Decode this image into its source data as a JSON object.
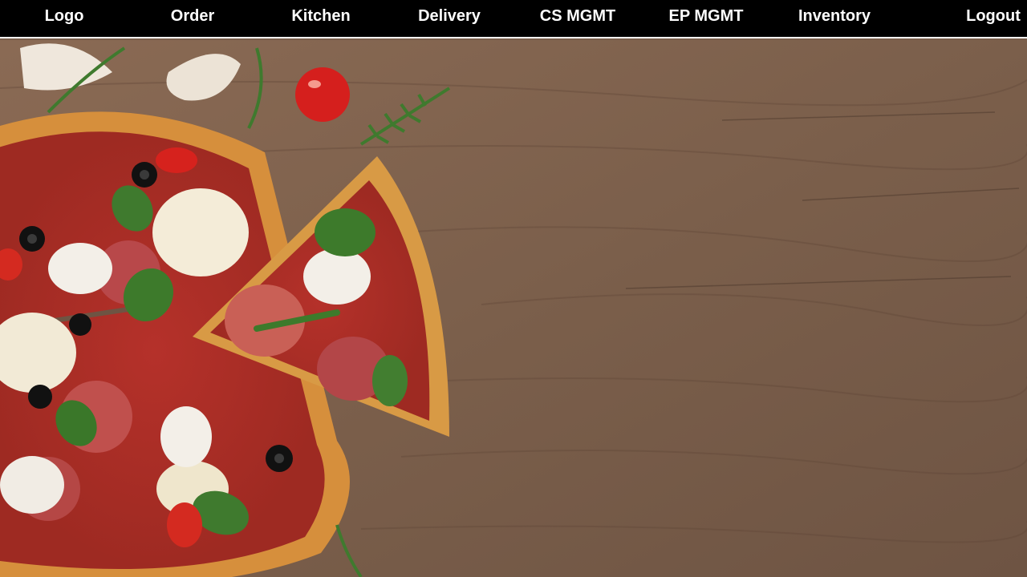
{
  "nav": {
    "logo": "Logo",
    "items": [
      "Order",
      "Kitchen",
      "Delivery",
      "CS MGMT",
      "EP MGMT",
      "Inventory"
    ],
    "logout": "Logout"
  },
  "hero": {
    "image": "pizza-on-wooden-table"
  },
  "colors": {
    "navbar_bg": "#000000",
    "navbar_text": "#ffffff",
    "wood": "#7a5f4c"
  }
}
